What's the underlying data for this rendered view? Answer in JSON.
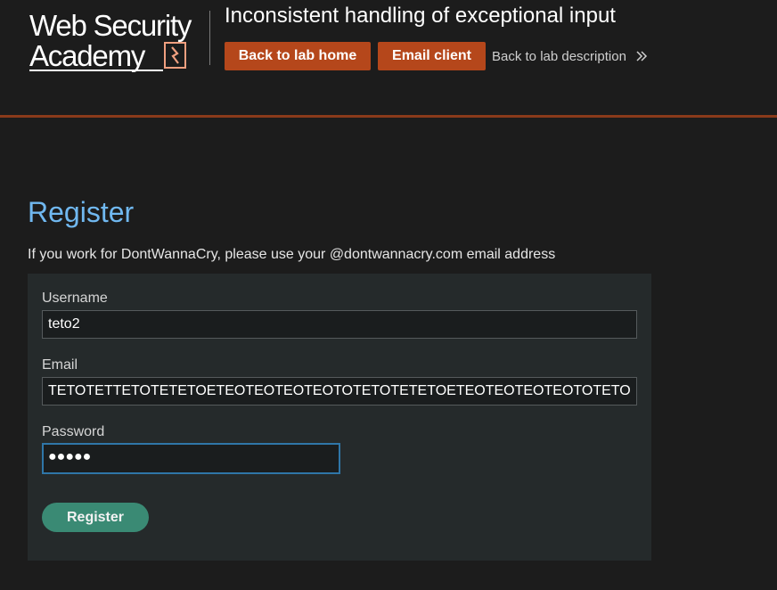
{
  "header": {
    "logo_line1": "Web Security",
    "logo_line2": "Academy",
    "lab_title": "Inconsistent handling of exceptional input",
    "back_home_label": "Back to lab home",
    "email_client_label": "Email client",
    "back_description_label": "Back to lab description"
  },
  "main": {
    "title": "Register",
    "note": "If you work for DontWannaCry, please use your @dontwannacry.com email address"
  },
  "form": {
    "username_label": "Username",
    "username_value": "teto2",
    "email_label": "Email",
    "email_value": "TETOTETTETOTETETOETEOTEOTEOTEOTOTETOTETETOETEOTEOTEOTEOTOTETO",
    "password_label": "Password",
    "password_value": "●●●●●",
    "register_label": "Register"
  },
  "colors": {
    "accent_orange": "#b5471b",
    "title_blue": "#70b8f0",
    "register_green": "#3a8a74",
    "focus_blue": "#2f76a8"
  }
}
